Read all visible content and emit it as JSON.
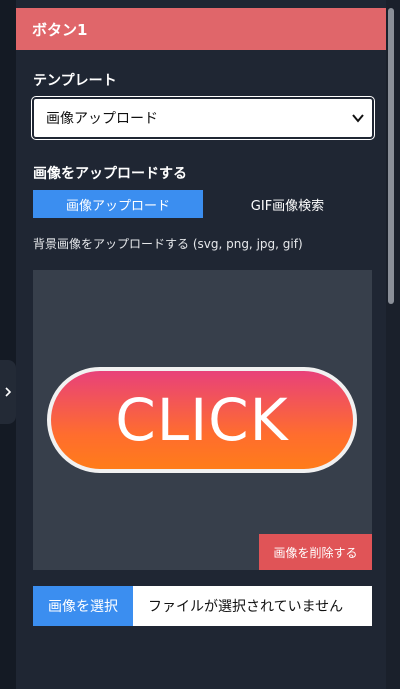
{
  "header": {
    "title": "ボタン1"
  },
  "template": {
    "label": "テンプレート",
    "selected": "画像アップロード"
  },
  "upload": {
    "label": "画像をアップロードする",
    "tabs": [
      {
        "label": "画像アップロード",
        "active": true
      },
      {
        "label": "GIF画像検索",
        "active": false
      }
    ],
    "hint": "背景画像をアップロードする (svg, png, jpg, gif)",
    "preview_text": "CLICK",
    "delete_label": "画像を削除する",
    "choose_label": "画像を選択",
    "file_status": "ファイルが選択されていません"
  },
  "colors": {
    "header": "#e0666a",
    "accent": "#3b8ef0",
    "danger": "#e05457",
    "panel": "#1f2633"
  },
  "icons": {
    "collapse": "chevron-right-icon",
    "select": "chevron-down-icon"
  }
}
